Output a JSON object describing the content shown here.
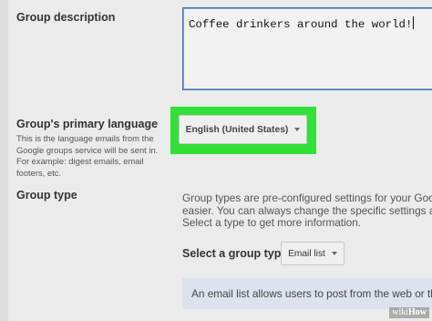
{
  "group_description": {
    "label": "Group description",
    "value": "Coffee drinkers around the world!"
  },
  "primary_language": {
    "label": "Group's primary language",
    "help_lines": [
      "This is the language emails from the",
      "Google groups service will be sent in.",
      "For example: digest emails, email",
      "footers, etc."
    ],
    "selected": "English (United States)",
    "highlight_color": "#33e03a"
  },
  "group_type": {
    "label": "Group type",
    "description_lines": [
      "Group types are pre-configured settings for your Googl",
      "easier. You can always change the specific settings an",
      "Select a type to get more information."
    ],
    "select_label": "Select a group type",
    "selected": "Email list",
    "info_text": "An email list allows users to post from the web or thro"
  },
  "watermark": {
    "prefix": "wiki",
    "suffix": "How"
  },
  "colors": {
    "background": "#ebebeb",
    "textarea_border": "#4d6fa8",
    "info_box": "#dde3ee"
  }
}
